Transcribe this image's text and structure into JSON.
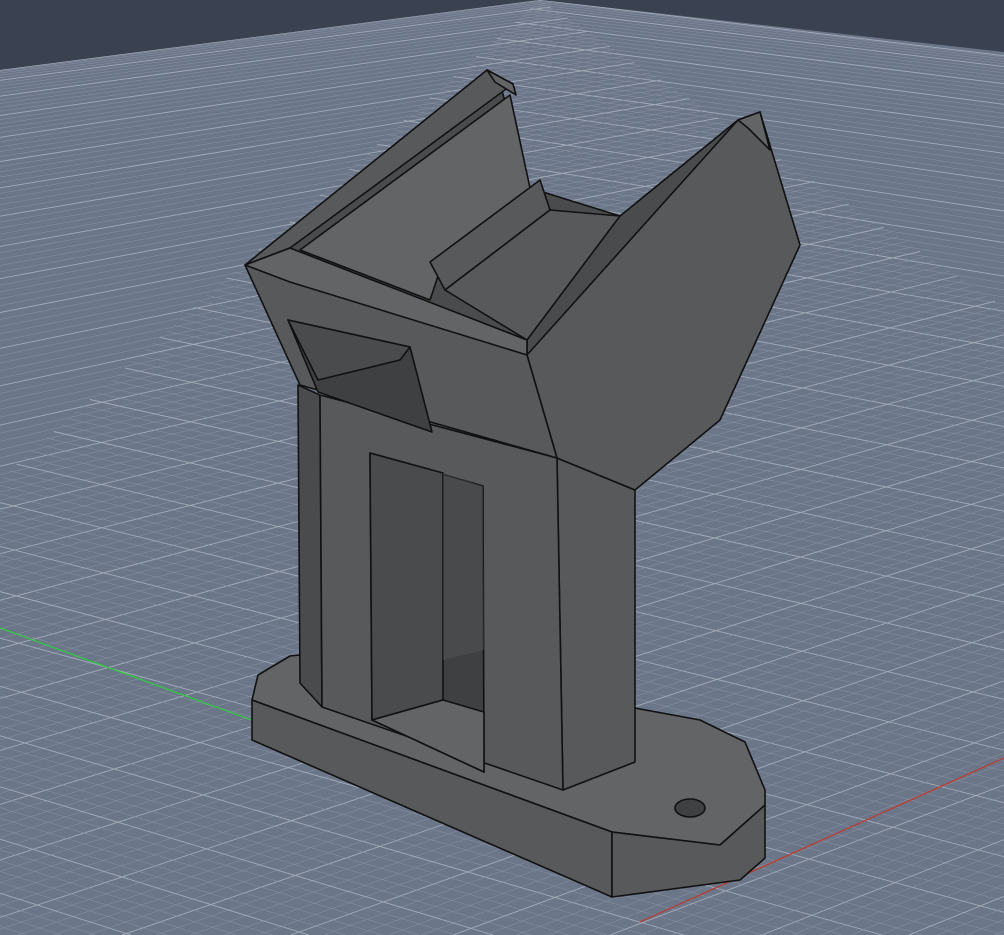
{
  "viewport": {
    "model": "bracket-mount",
    "colors": {
      "background": "#3a4150",
      "ground_plane": "#6c7689",
      "grid_minor": "#8a93a3",
      "grid_major": "#a3abb8",
      "x_axis": "#c0392b",
      "y_axis": "#2ecc40",
      "face_light": "#636466",
      "face_mid": "#58595b",
      "face_dark": "#4a4b4d",
      "face_darkest": "#3f4042"
    }
  }
}
